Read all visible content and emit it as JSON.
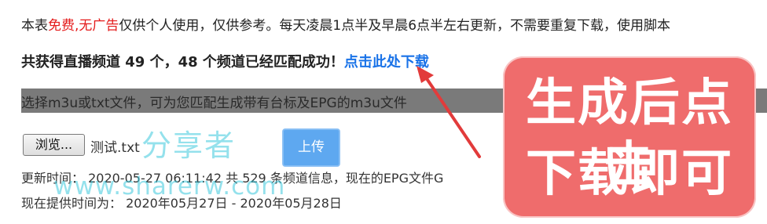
{
  "notice": {
    "prefix": "本表",
    "free": "免费,",
    "no_ads": "无广告",
    "rest": "仅供个人使用，仅供参考。每天凌晨1点半及早晨6点半左右更新，不需要重复下载，使用脚本"
  },
  "headline": {
    "text": "共获得直播频道 49 个，48 个频道已经匹配成功！",
    "download_link": "点击此处下载"
  },
  "upload_section": {
    "instruction": "选择m3u或txt文件，可为您匹配生成带有台标及EPG的m3u文件",
    "browse_button": "浏览...",
    "file_name": "测试.txt",
    "upload_button": "上传"
  },
  "info": {
    "update_line": "更新时间： 2020-05-27 06:11:42 共 529 条频道信息，现在的EPG文件G",
    "provide_line": "现在提供时间为： 2020年05月27日 - 2020年05月28日"
  },
  "watermark": {
    "cn": "分享者",
    "url": "www.sharerw.com"
  },
  "callout": {
    "line1": "生成后点击",
    "line2": "下载即可"
  },
  "colors": {
    "link": "#1a73e8",
    "red": "#e41b1b",
    "callout_bg": "#ef6c6c",
    "arrow": "#e23b3b",
    "upload_button": "#5ea8f0"
  }
}
